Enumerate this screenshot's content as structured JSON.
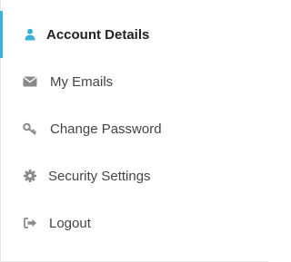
{
  "colors": {
    "active_bar": "#3bb1d9",
    "active_icon": "#3bb1d9",
    "icon": "#8a8a8a",
    "text": "#444444",
    "active_text": "#222222"
  },
  "menu": {
    "items": [
      {
        "label": "Account Details",
        "icon": "user-icon",
        "active": true
      },
      {
        "label": "My Emails",
        "icon": "envelope-icon",
        "active": false
      },
      {
        "label": "Change Password",
        "icon": "key-icon",
        "active": false
      },
      {
        "label": "Security Settings",
        "icon": "gear-icon",
        "active": false
      },
      {
        "label": "Logout",
        "icon": "sign-out-icon",
        "active": false
      }
    ]
  }
}
